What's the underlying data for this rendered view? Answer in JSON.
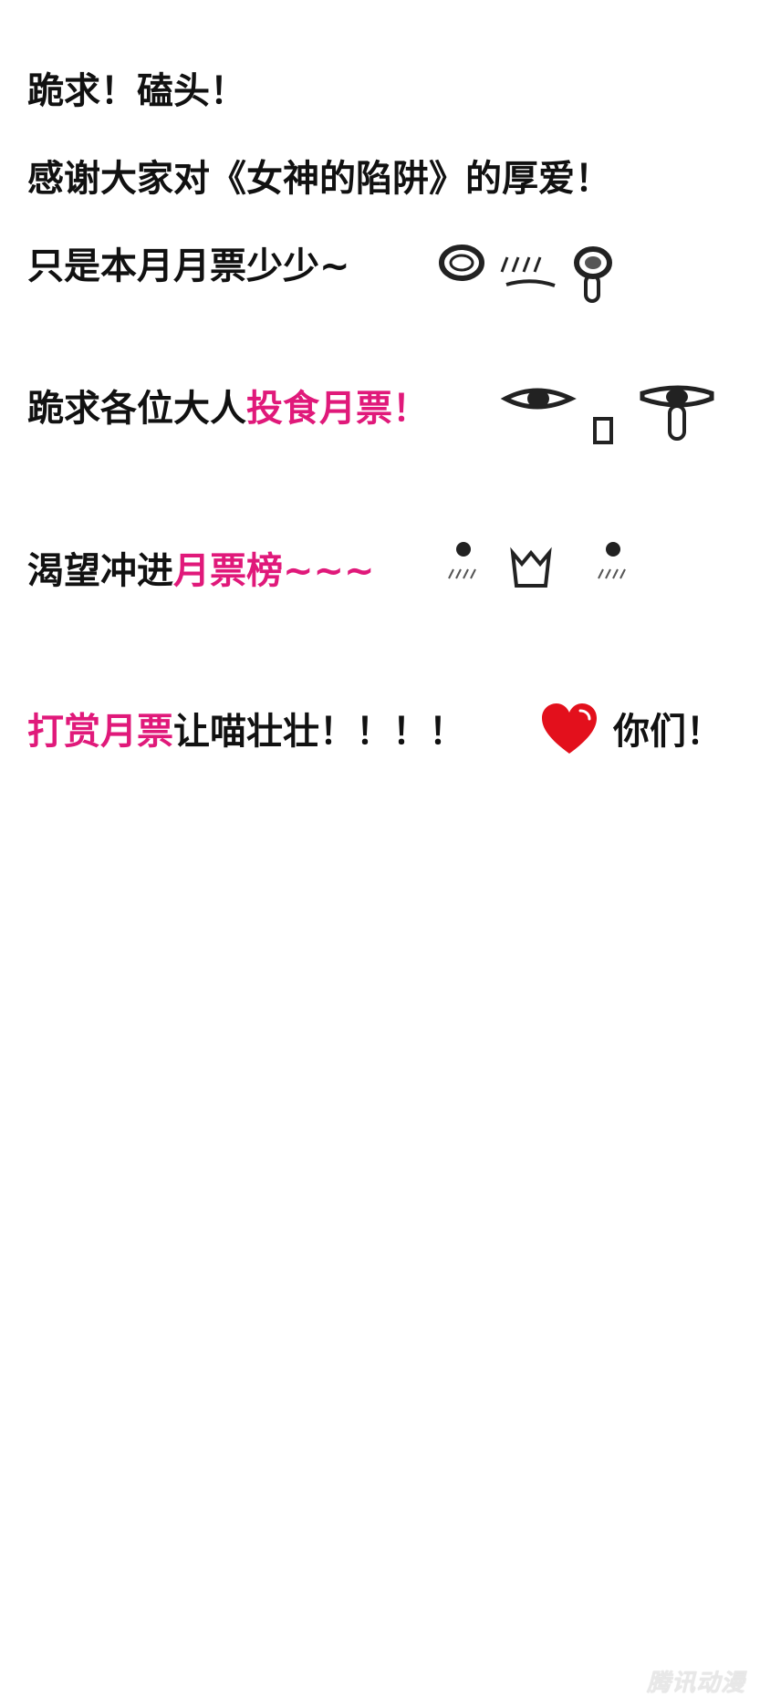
{
  "lines": {
    "l1": "跪求！磕头！",
    "l2": "感谢大家对《女神的陷阱》的厚爱！",
    "l3": "只是本月月票少少~",
    "l4_a": "跪求各位大人",
    "l4_b": "投食月票！",
    "l5_a": "渴望冲进",
    "l5_b": "月票榜~~~",
    "l6_a": "打赏月票",
    "l6_b": "让喵壮壮！！！！",
    "l6_c": "你们！"
  },
  "icons": {
    "face1": "shocked-drooling-face-icon",
    "face2": "drooling-face-icon",
    "face3": "blushing-face-icon",
    "heart": "heart-icon"
  },
  "colors": {
    "text": "#111111",
    "accent": "#e0197a",
    "heart": "#e3101c"
  },
  "watermark": "腾讯动漫"
}
